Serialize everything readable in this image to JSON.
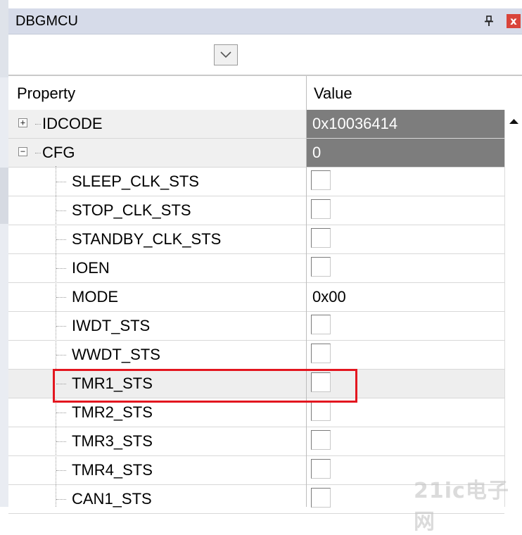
{
  "window": {
    "title": "DBGMCU"
  },
  "icons": {
    "pin": "pin-icon",
    "close": "close-icon",
    "dropdown": "chevron-down-icon",
    "scroll_up": "arrow-up-icon"
  },
  "colors": {
    "highlight": "#e3161f",
    "group_value_bg": "#7d7d7d",
    "title_bg": "#d6dbe9"
  },
  "grid": {
    "headers": {
      "property": "Property",
      "value": "Value"
    },
    "groups": [
      {
        "name": "IDCODE",
        "value": "0x10036414",
        "expanded": false,
        "toggle": "+"
      },
      {
        "name": "CFG",
        "value": "0",
        "expanded": true,
        "toggle": "−"
      }
    ],
    "fields": [
      {
        "name": "SLEEP_CLK_STS",
        "type": "checkbox",
        "checked": false
      },
      {
        "name": "STOP_CLK_STS",
        "type": "checkbox",
        "checked": false
      },
      {
        "name": "STANDBY_CLK_STS",
        "type": "checkbox",
        "checked": false
      },
      {
        "name": "IOEN",
        "type": "checkbox",
        "checked": false
      },
      {
        "name": "MODE",
        "type": "text",
        "value": "0x00"
      },
      {
        "name": "IWDT_STS",
        "type": "checkbox",
        "checked": false
      },
      {
        "name": "WWDT_STS",
        "type": "checkbox",
        "checked": false
      },
      {
        "name": "TMR1_STS",
        "type": "checkbox",
        "checked": false,
        "selected": true
      },
      {
        "name": "TMR2_STS",
        "type": "checkbox",
        "checked": false
      },
      {
        "name": "TMR3_STS",
        "type": "checkbox",
        "checked": false
      },
      {
        "name": "TMR4_STS",
        "type": "checkbox",
        "checked": false
      },
      {
        "name": "CAN1_STS",
        "type": "checkbox",
        "checked": false
      }
    ]
  },
  "watermark": "21ic电子网"
}
